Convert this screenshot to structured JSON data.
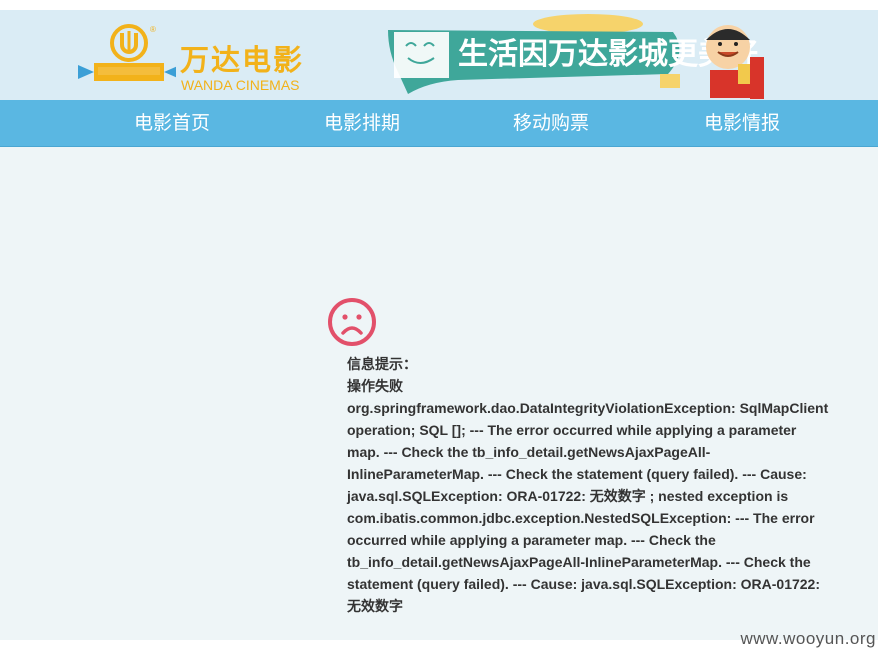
{
  "header": {
    "logo_cn": "万达电影",
    "logo_en": "WANDA CINEMAS",
    "logo_badge": "万达影城",
    "banner_slogan": "生活因万达影城更美好"
  },
  "nav": {
    "items": [
      {
        "label": "电影首页"
      },
      {
        "label": "电影排期"
      },
      {
        "label": "移动购票"
      },
      {
        "label": "电影情报"
      }
    ]
  },
  "message": {
    "title": "信息提示：",
    "status": "操作失败",
    "detail": "org.springframework.dao.DataIntegrityViolationException: SqlMapClient operation; SQL []; --- The error occurred while applying a parameter map. --- Check the tb_info_detail.getNewsAjaxPageAll-InlineParameterMap. --- Check the statement (query failed). --- Cause: java.sql.SQLException: ORA-01722: 无效数字 ; nested exception is com.ibatis.common.jdbc.exception.NestedSQLException: --- The error occurred while applying a parameter map. --- Check the tb_info_detail.getNewsAjaxPageAll-InlineParameterMap. --- Check the statement (query failed). --- Cause: java.sql.SQLException: ORA-01722: 无效数字"
  },
  "watermark": "www.wooyun.org",
  "colors": {
    "nav_bg": "#5ab7e2",
    "header_bg": "#daecf5",
    "brand_yellow": "#f2b21a",
    "sad_face": "#e2506a",
    "banner_teal": "#3fa79a"
  },
  "icons": {
    "sad_face": "sad-face-icon"
  }
}
